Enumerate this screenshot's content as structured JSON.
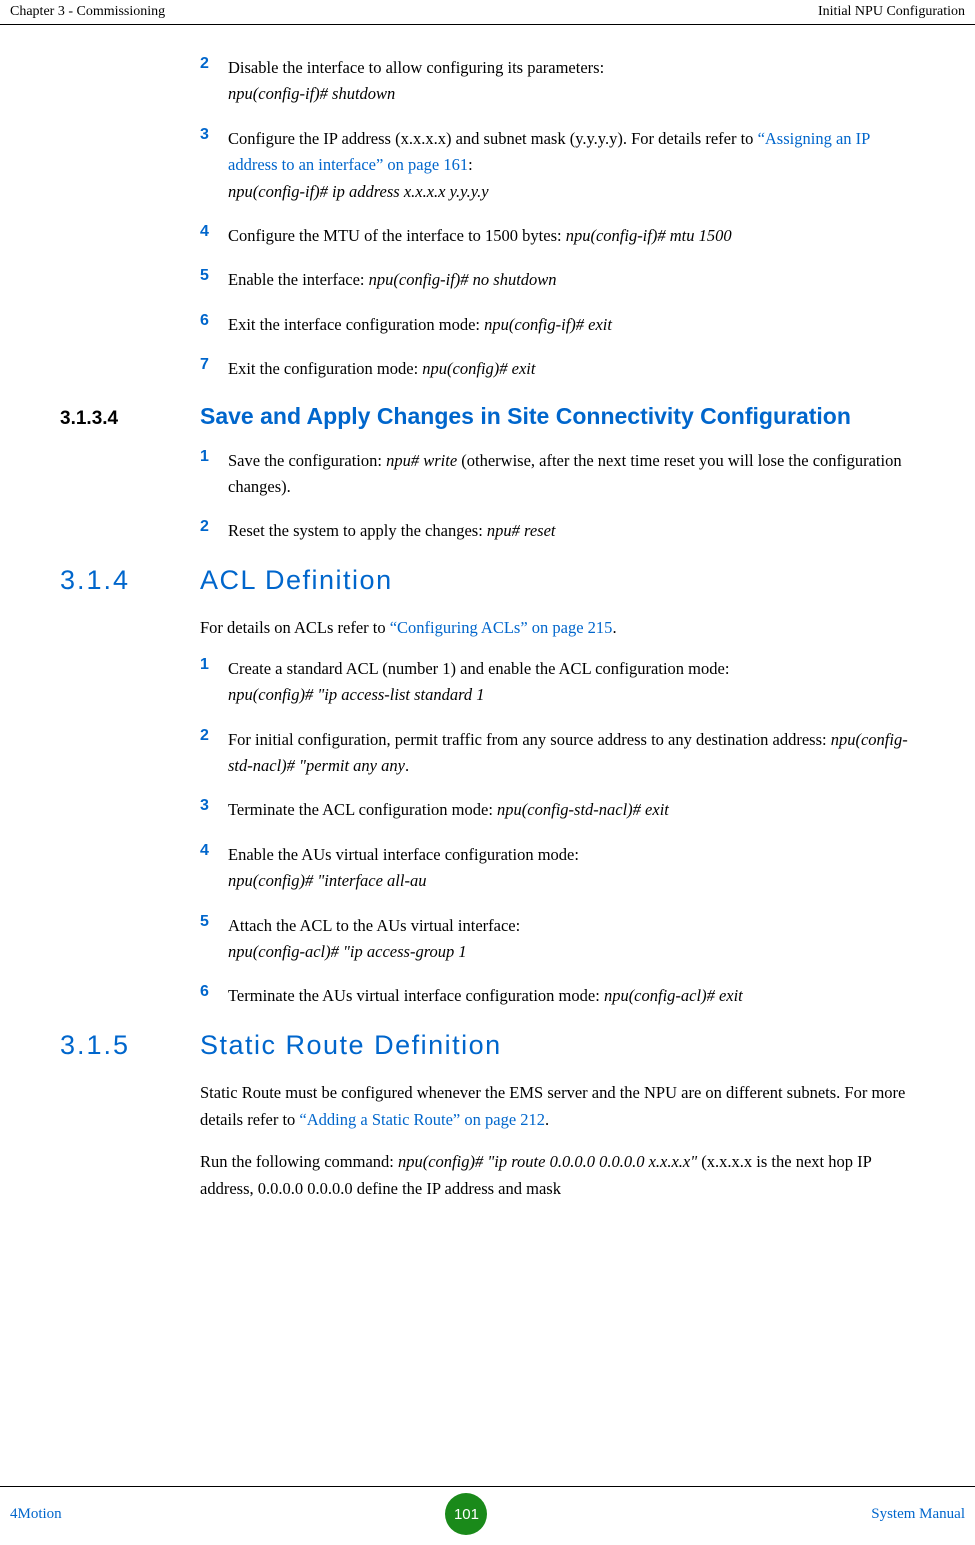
{
  "header": {
    "left": "Chapter 3 - Commissioning",
    "right": "Initial NPU Configuration"
  },
  "steps_a": [
    {
      "num": "2",
      "text": "Disable the interface to allow configuring its parameters:",
      "cmd": "npu(config-if)# shutdown"
    },
    {
      "num": "3",
      "text_before": "Configure the IP address (x.x.x.x) and subnet mask (y.y.y.y). For details refer to  ",
      "link": "“Assigning an IP address to an interface” on page 161",
      "text_after": ":",
      "cmd": "npu(config-if)# ip address x.x.x.x y.y.y.y"
    },
    {
      "num": "4",
      "text": "Configure the MTU of the interface to 1500 bytes: ",
      "cmd_inline": "npu(config-if)# mtu 1500"
    },
    {
      "num": "5",
      "text": "Enable the interface: ",
      "cmd_inline": "npu(config-if)# no shutdown"
    },
    {
      "num": "6",
      "text": "Exit the interface configuration mode: ",
      "cmd_inline": "npu(config-if)# exit"
    },
    {
      "num": "7",
      "text": "Exit the configuration mode: ",
      "cmd_inline": "npu(config)# exit"
    }
  ],
  "section_3134": {
    "num": "3.1.3.4",
    "title": "Save and Apply Changes in Site Connectivity Configuration"
  },
  "steps_b": [
    {
      "num": "1",
      "text_before": "Save the configuration: ",
      "cmd_inline": "npu# write",
      "text_after": " (otherwise, after the next time reset you will lose the configuration changes)."
    },
    {
      "num": "2",
      "text": "Reset the system to apply the changes: ",
      "cmd_inline": "npu# reset"
    }
  ],
  "section_314": {
    "num": "3.1.4",
    "title": "ACL Definition"
  },
  "para_314": {
    "before": "For details on ACLs refer to ",
    "link": "“Configuring ACLs” on page 215",
    "after": "."
  },
  "steps_c": [
    {
      "num": "1",
      "text": "Create a standard ACL (number 1) and enable the ACL configuration mode:",
      "cmd": "npu(config)# \"ip access-list standard 1"
    },
    {
      "num": "2",
      "text_before": "For initial configuration, permit traffic from any source address to any destination address: ",
      "cmd_inline": "npu(config-std-nacl)# \"permit any any",
      "text_after": "."
    },
    {
      "num": "3",
      "text": "Terminate the ACL configuration mode: ",
      "cmd_inline": "npu(config-std-nacl)# exit"
    },
    {
      "num": "4",
      "text": "Enable the AUs virtual interface configuration mode:",
      "cmd": "npu(config)# \"interface all-au"
    },
    {
      "num": "5",
      "text": "Attach the ACL to the AUs virtual interface:",
      "cmd": "npu(config-acl)# \"ip access-group 1"
    },
    {
      "num": "6",
      "text": "Terminate the AUs virtual interface configuration mode: ",
      "cmd_inline": "npu(config-acl)# exit"
    }
  ],
  "section_315": {
    "num": "3.1.5",
    "title": "Static Route Definition"
  },
  "para_315a": {
    "before": "Static Route must be configured whenever the EMS server and the NPU are on different subnets. For more details refer to ",
    "link": "“Adding a Static Route” on page 212",
    "after": "."
  },
  "para_315b": {
    "text_before": "Run the following command: ",
    "cmd_inline": "npu(config)# \"ip route 0.0.0.0 0.0.0.0 x.x.x.x\"",
    "text_after": " (x.x.x.x is the next hop IP address, 0.0.0.0 0.0.0.0 define the IP address and mask"
  },
  "footer": {
    "left": "4Motion",
    "page": "101",
    "right": "System Manual"
  }
}
